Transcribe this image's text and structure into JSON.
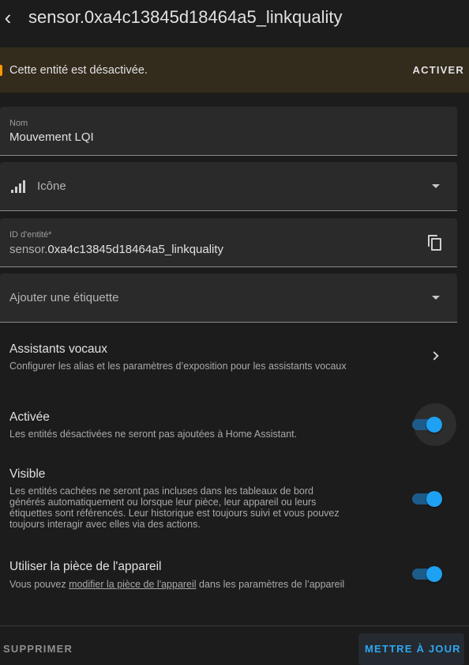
{
  "header": {
    "title": "sensor.0xa4c13845d18464a5_linkquality"
  },
  "banner": {
    "text": "Cette entité est désactivée.",
    "action": "ACTIVER"
  },
  "fields": {
    "name": {
      "label": "Nom",
      "value": "Mouvement LQI"
    },
    "icon": {
      "placeholder": "Icône",
      "icon": "signal-cellular-icon"
    },
    "entity_id": {
      "label": "ID d'entité*",
      "prefix": "sensor.",
      "value": "0xa4c13845d18464a5_linkquality"
    },
    "label": {
      "placeholder": "Ajouter une étiquette"
    }
  },
  "voice_assistants": {
    "title": "Assistants vocaux",
    "description": "Configurer les alias et les paramètres d’exposition pour les assistants vocaux"
  },
  "enabled": {
    "title": "Activée",
    "description": "Les entités désactivées ne seront pas ajoutées à Home Assistant.",
    "state": true
  },
  "visible": {
    "title": "Visible",
    "description_lines": [
      "Les entités cachées ne seront pas incluses dans les tableaux de bord",
      "générés automatiquement ou lorsque leur pièce, leur appareil ou leurs",
      "étiquettes sont référencés. Leur historique est toujours suivi et vous pouvez",
      "toujours interagir avec elles via des actions."
    ],
    "state": true
  },
  "use_device_area": {
    "title": "Utiliser la pièce de l'appareil",
    "description_before": "Vous pouvez ",
    "description_link": "modifier la pièce de l'appareil",
    "description_after": " dans les paramètres de l’appareil",
    "state": true
  },
  "footer": {
    "delete": "SUPPRIMER",
    "update": "METTRE À JOUR"
  },
  "colors": {
    "accent": "#1ea1f2",
    "warning": "#ff9800",
    "background": "#1c1c1c"
  }
}
